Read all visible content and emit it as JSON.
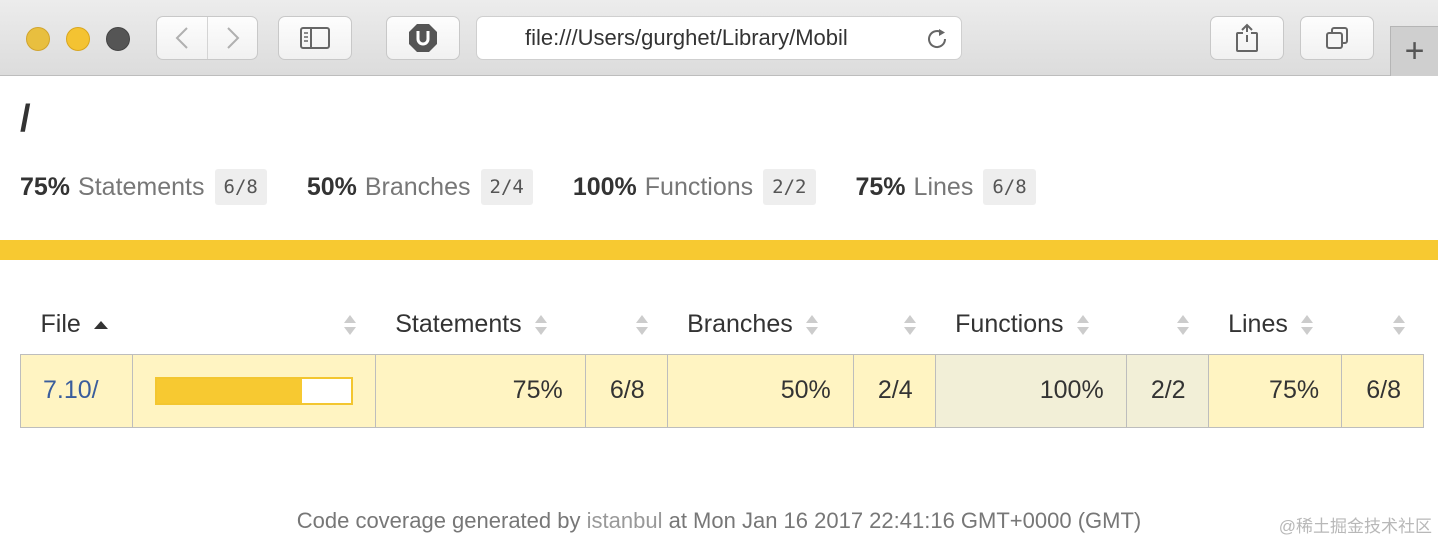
{
  "browser": {
    "address": "file:///Users/gurghet/Library/Mobil",
    "newtab_label": "+"
  },
  "page": {
    "title": "/"
  },
  "summary": [
    {
      "pct": "75%",
      "label": "Statements",
      "fraction": "6/8"
    },
    {
      "pct": "50%",
      "label": "Branches",
      "fraction": "2/4"
    },
    {
      "pct": "100%",
      "label": "Functions",
      "fraction": "2/2"
    },
    {
      "pct": "75%",
      "label": "Lines",
      "fraction": "6/8"
    }
  ],
  "table": {
    "headers": {
      "file": "File",
      "statements": "Statements",
      "branches": "Branches",
      "functions": "Functions",
      "lines": "Lines"
    },
    "rows": [
      {
        "file": "7.10/",
        "coverage_fraction": 0.75,
        "statements_pct": "75%",
        "statements_frac": "6/8",
        "branches_pct": "50%",
        "branches_frac": "2/4",
        "functions_pct": "100%",
        "functions_frac": "2/2",
        "lines_pct": "75%",
        "lines_frac": "6/8"
      }
    ]
  },
  "footer": {
    "prefix": "Code coverage generated by",
    "link": "istanbul",
    "suffix": "at Mon Jan 16 2017 22:41:16 GMT+0000 (GMT)"
  },
  "watermark": "@稀土掘金技术社区",
  "colors": {
    "status_medium": "#f7c931",
    "row_medium": "#fff4c2",
    "row_high": "#f2efd7"
  }
}
